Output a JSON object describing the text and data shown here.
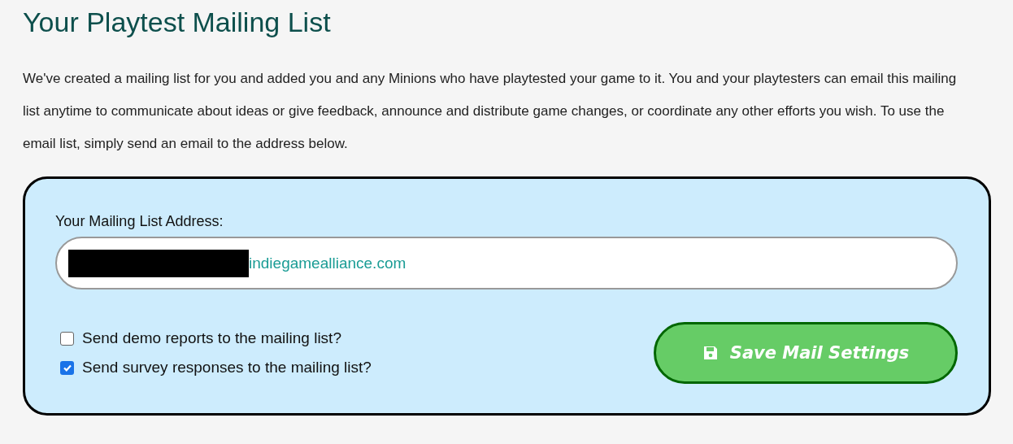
{
  "title": "Your Playtest Mailing List",
  "intro": "We've created a mailing list for you and added you and any Minions who have playtested your game to it. You and your playtesters can email this mailing list anytime to communicate about ideas or give feedback, announce and distribute game changes, or coordinate any other efforts you wish. To use the email list, simply send an email to the address below.",
  "mailing_list": {
    "label": "Your Mailing List Address:",
    "address": {
      "redacted": true,
      "value": "indiegamealliance.com"
    },
    "options": [
      {
        "label": "Send demo reports to the mailing list?",
        "checked": false
      },
      {
        "label": "Send survey responses to the mailing list?",
        "checked": true
      }
    ],
    "save_button": "Save Mail Settings"
  }
}
